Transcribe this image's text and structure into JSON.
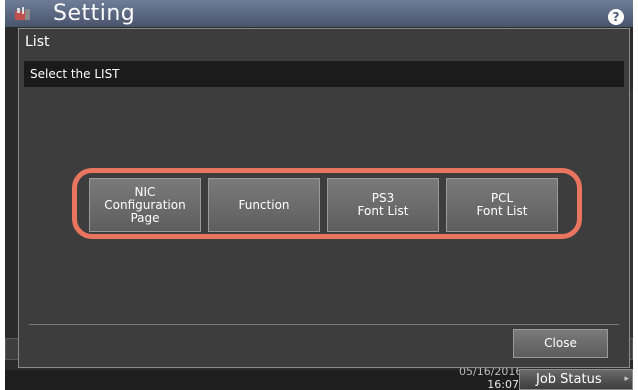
{
  "app": {
    "title": "Setting",
    "help_glyph": "?"
  },
  "dialog": {
    "title": "List",
    "instruction": "Select the LIST",
    "buttons": [
      {
        "label": "NIC\nConfiguration\nPage"
      },
      {
        "label": "Function"
      },
      {
        "label": "PS3\nFont List"
      },
      {
        "label": "PCL\nFont List"
      }
    ],
    "close_label": "Close"
  },
  "status_bar": {
    "date": "05/16/2016",
    "time": "16:07",
    "job_status_label": "Job Status"
  },
  "colors": {
    "highlight": "#e9745f",
    "dialog_bg": "#3d3d3d",
    "instruction_bg": "#1b1b1b",
    "header_bg": "#5b6882",
    "button_bg": "#6d6d6d"
  }
}
